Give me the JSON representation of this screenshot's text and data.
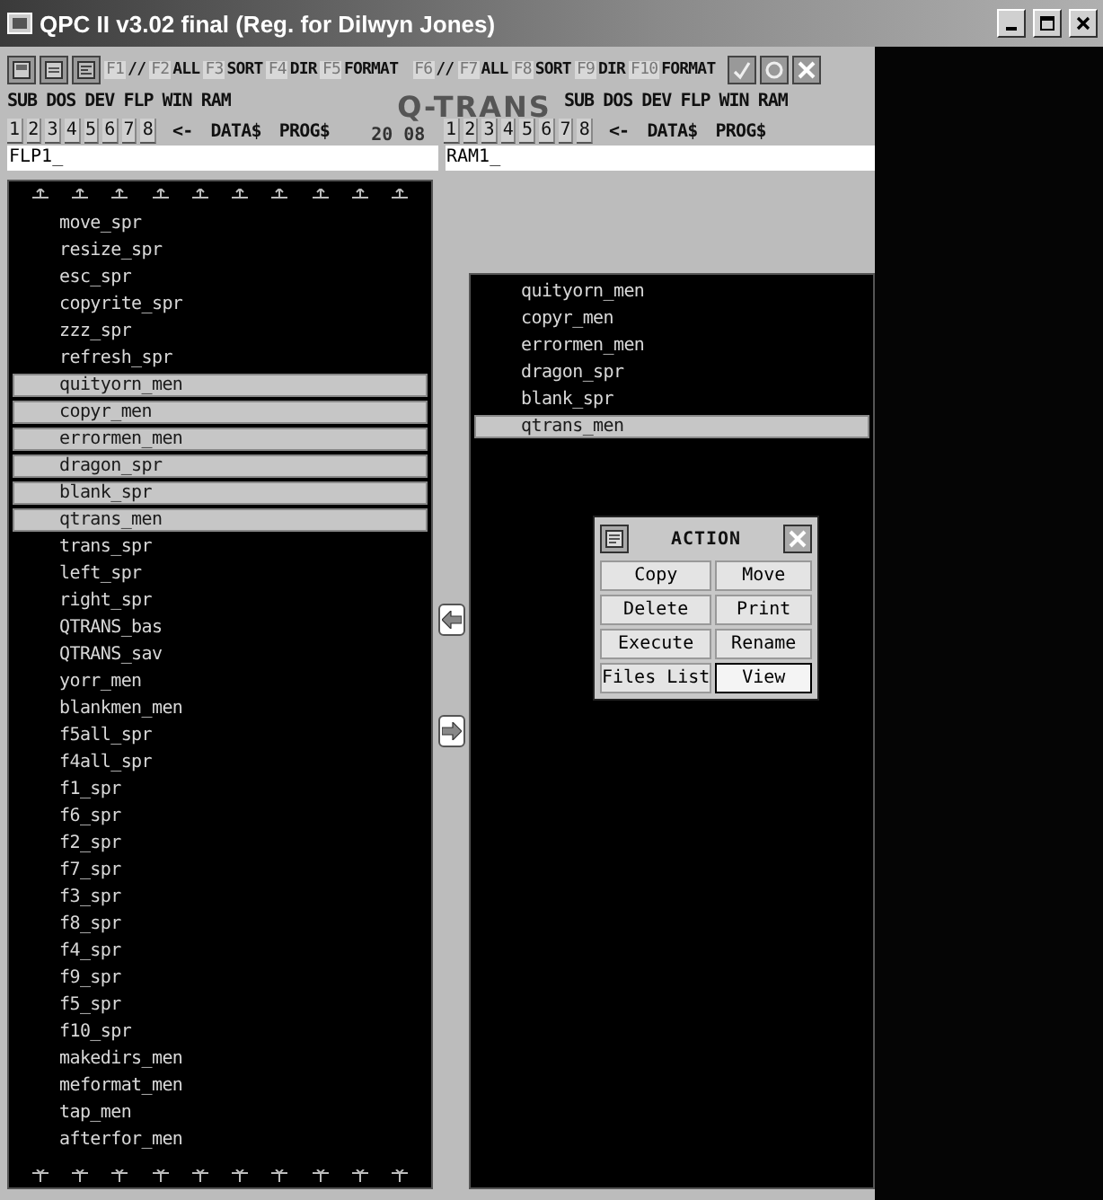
{
  "window": {
    "title": "QPC II v3.02 final (Reg. for Dilwyn Jones)"
  },
  "toolbar": {
    "function_keys": [
      {
        "key": "F1",
        "label": "//"
      },
      {
        "key": "F2",
        "label": "ALL"
      },
      {
        "key": "F3",
        "label": "SORT"
      },
      {
        "key": "F4",
        "label": "DIR"
      },
      {
        "key": "F5",
        "label": "FORMAT"
      },
      {
        "key": "F6",
        "label": "//"
      },
      {
        "key": "F7",
        "label": "ALL"
      },
      {
        "key": "F8",
        "label": "SORT"
      },
      {
        "key": "F9",
        "label": "DIR"
      },
      {
        "key": "F10",
        "label": "FORMAT"
      }
    ]
  },
  "menus": [
    {
      "items": [
        "SUB",
        "DOS",
        "DEV",
        "FLP",
        "WIN",
        "RAM"
      ]
    },
    {
      "items": [
        "SUB",
        "DOS",
        "DEV",
        "FLP",
        "WIN",
        "RAM"
      ]
    }
  ],
  "logo": "Q-TRANS",
  "quick_keys": [
    {
      "items": [
        "1",
        "2",
        "3",
        "4",
        "5",
        "6",
        "7",
        "8",
        "<-",
        "DATA$",
        "PROG$"
      ]
    },
    {
      "items": [
        "1",
        "2",
        "3",
        "4",
        "5",
        "6",
        "7",
        "8",
        "<-",
        "DATA$",
        "PROG$"
      ]
    }
  ],
  "counter": [
    "20",
    "08"
  ],
  "paths": [
    "FLP1_",
    "RAM1_"
  ],
  "left_list": {
    "items": [
      {
        "name": "move_spr",
        "selected": false
      },
      {
        "name": "resize_spr",
        "selected": false
      },
      {
        "name": "esc_spr",
        "selected": false
      },
      {
        "name": "copyrite_spr",
        "selected": false
      },
      {
        "name": "zzz_spr",
        "selected": false
      },
      {
        "name": "refresh_spr",
        "selected": false
      },
      {
        "name": "quityorn_men",
        "selected": true
      },
      {
        "name": "copyr_men",
        "selected": true
      },
      {
        "name": "errormen_men",
        "selected": true
      },
      {
        "name": "dragon_spr",
        "selected": true
      },
      {
        "name": "blank_spr",
        "selected": true
      },
      {
        "name": "qtrans_men",
        "selected": true
      },
      {
        "name": "trans_spr",
        "selected": false
      },
      {
        "name": "left_spr",
        "selected": false
      },
      {
        "name": "right_spr",
        "selected": false
      },
      {
        "name": "QTRANS_bas",
        "selected": false
      },
      {
        "name": "QTRANS_sav",
        "selected": false
      },
      {
        "name": "yorr_men",
        "selected": false
      },
      {
        "name": "blankmen_men",
        "selected": false
      },
      {
        "name": "f5all_spr",
        "selected": false
      },
      {
        "name": "f4all_spr",
        "selected": false
      },
      {
        "name": "f1_spr",
        "selected": false
      },
      {
        "name": "f6_spr",
        "selected": false
      },
      {
        "name": "f2_spr",
        "selected": false
      },
      {
        "name": "f7_spr",
        "selected": false
      },
      {
        "name": "f3_spr",
        "selected": false
      },
      {
        "name": "f8_spr",
        "selected": false
      },
      {
        "name": "f4_spr",
        "selected": false
      },
      {
        "name": "f9_spr",
        "selected": false
      },
      {
        "name": "f5_spr",
        "selected": false
      },
      {
        "name": "f10_spr",
        "selected": false
      },
      {
        "name": "makedirs_men",
        "selected": false
      },
      {
        "name": "meformat_men",
        "selected": false
      },
      {
        "name": "tap_men",
        "selected": false
      },
      {
        "name": "afterfor_men",
        "selected": false
      }
    ]
  },
  "right_list": {
    "items": [
      {
        "name": "quityorn_men",
        "selected": false
      },
      {
        "name": "copyr_men",
        "selected": false
      },
      {
        "name": "errormen_men",
        "selected": false
      },
      {
        "name": "dragon_spr",
        "selected": false
      },
      {
        "name": "blank_spr",
        "selected": false
      },
      {
        "name": "qtrans_men",
        "selected": true
      }
    ]
  },
  "dialog": {
    "title": "ACTION",
    "buttons": [
      {
        "label": "Copy",
        "selected": false
      },
      {
        "label": "Move",
        "selected": false
      },
      {
        "label": "Delete",
        "selected": false
      },
      {
        "label": "Print",
        "selected": false
      },
      {
        "label": "Execute",
        "selected": false
      },
      {
        "label": "Rename",
        "selected": false
      },
      {
        "label": "Files List",
        "selected": false
      },
      {
        "label": "View",
        "selected": true
      }
    ]
  }
}
